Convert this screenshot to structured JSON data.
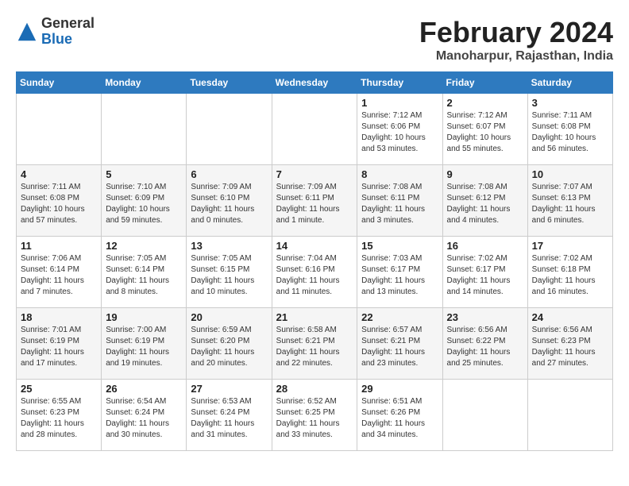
{
  "header": {
    "logo": {
      "general": "General",
      "blue": "Blue"
    },
    "title": "February 2024",
    "location": "Manoharpur, Rajasthan, India"
  },
  "weekdays": [
    "Sunday",
    "Monday",
    "Tuesday",
    "Wednesday",
    "Thursday",
    "Friday",
    "Saturday"
  ],
  "weeks": [
    [
      {
        "day": "",
        "info": ""
      },
      {
        "day": "",
        "info": ""
      },
      {
        "day": "",
        "info": ""
      },
      {
        "day": "",
        "info": ""
      },
      {
        "day": "1",
        "info": "Sunrise: 7:12 AM\nSunset: 6:06 PM\nDaylight: 10 hours\nand 53 minutes."
      },
      {
        "day": "2",
        "info": "Sunrise: 7:12 AM\nSunset: 6:07 PM\nDaylight: 10 hours\nand 55 minutes."
      },
      {
        "day": "3",
        "info": "Sunrise: 7:11 AM\nSunset: 6:08 PM\nDaylight: 10 hours\nand 56 minutes."
      }
    ],
    [
      {
        "day": "4",
        "info": "Sunrise: 7:11 AM\nSunset: 6:08 PM\nDaylight: 10 hours\nand 57 minutes."
      },
      {
        "day": "5",
        "info": "Sunrise: 7:10 AM\nSunset: 6:09 PM\nDaylight: 10 hours\nand 59 minutes."
      },
      {
        "day": "6",
        "info": "Sunrise: 7:09 AM\nSunset: 6:10 PM\nDaylight: 11 hours\nand 0 minutes."
      },
      {
        "day": "7",
        "info": "Sunrise: 7:09 AM\nSunset: 6:11 PM\nDaylight: 11 hours\nand 1 minute."
      },
      {
        "day": "8",
        "info": "Sunrise: 7:08 AM\nSunset: 6:11 PM\nDaylight: 11 hours\nand 3 minutes."
      },
      {
        "day": "9",
        "info": "Sunrise: 7:08 AM\nSunset: 6:12 PM\nDaylight: 11 hours\nand 4 minutes."
      },
      {
        "day": "10",
        "info": "Sunrise: 7:07 AM\nSunset: 6:13 PM\nDaylight: 11 hours\nand 6 minutes."
      }
    ],
    [
      {
        "day": "11",
        "info": "Sunrise: 7:06 AM\nSunset: 6:14 PM\nDaylight: 11 hours\nand 7 minutes."
      },
      {
        "day": "12",
        "info": "Sunrise: 7:05 AM\nSunset: 6:14 PM\nDaylight: 11 hours\nand 8 minutes."
      },
      {
        "day": "13",
        "info": "Sunrise: 7:05 AM\nSunset: 6:15 PM\nDaylight: 11 hours\nand 10 minutes."
      },
      {
        "day": "14",
        "info": "Sunrise: 7:04 AM\nSunset: 6:16 PM\nDaylight: 11 hours\nand 11 minutes."
      },
      {
        "day": "15",
        "info": "Sunrise: 7:03 AM\nSunset: 6:17 PM\nDaylight: 11 hours\nand 13 minutes."
      },
      {
        "day": "16",
        "info": "Sunrise: 7:02 AM\nSunset: 6:17 PM\nDaylight: 11 hours\nand 14 minutes."
      },
      {
        "day": "17",
        "info": "Sunrise: 7:02 AM\nSunset: 6:18 PM\nDaylight: 11 hours\nand 16 minutes."
      }
    ],
    [
      {
        "day": "18",
        "info": "Sunrise: 7:01 AM\nSunset: 6:19 PM\nDaylight: 11 hours\nand 17 minutes."
      },
      {
        "day": "19",
        "info": "Sunrise: 7:00 AM\nSunset: 6:19 PM\nDaylight: 11 hours\nand 19 minutes."
      },
      {
        "day": "20",
        "info": "Sunrise: 6:59 AM\nSunset: 6:20 PM\nDaylight: 11 hours\nand 20 minutes."
      },
      {
        "day": "21",
        "info": "Sunrise: 6:58 AM\nSunset: 6:21 PM\nDaylight: 11 hours\nand 22 minutes."
      },
      {
        "day": "22",
        "info": "Sunrise: 6:57 AM\nSunset: 6:21 PM\nDaylight: 11 hours\nand 23 minutes."
      },
      {
        "day": "23",
        "info": "Sunrise: 6:56 AM\nSunset: 6:22 PM\nDaylight: 11 hours\nand 25 minutes."
      },
      {
        "day": "24",
        "info": "Sunrise: 6:56 AM\nSunset: 6:23 PM\nDaylight: 11 hours\nand 27 minutes."
      }
    ],
    [
      {
        "day": "25",
        "info": "Sunrise: 6:55 AM\nSunset: 6:23 PM\nDaylight: 11 hours\nand 28 minutes."
      },
      {
        "day": "26",
        "info": "Sunrise: 6:54 AM\nSunset: 6:24 PM\nDaylight: 11 hours\nand 30 minutes."
      },
      {
        "day": "27",
        "info": "Sunrise: 6:53 AM\nSunset: 6:24 PM\nDaylight: 11 hours\nand 31 minutes."
      },
      {
        "day": "28",
        "info": "Sunrise: 6:52 AM\nSunset: 6:25 PM\nDaylight: 11 hours\nand 33 minutes."
      },
      {
        "day": "29",
        "info": "Sunrise: 6:51 AM\nSunset: 6:26 PM\nDaylight: 11 hours\nand 34 minutes."
      },
      {
        "day": "",
        "info": ""
      },
      {
        "day": "",
        "info": ""
      }
    ]
  ]
}
